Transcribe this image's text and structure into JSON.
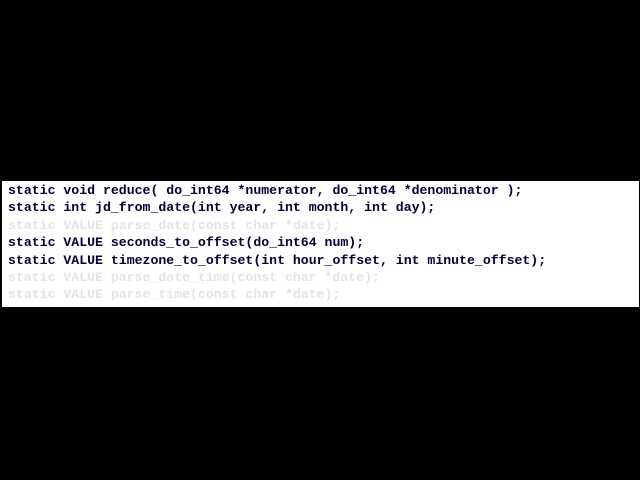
{
  "colors": {
    "background": "#000000",
    "panel": "#ffffff",
    "text_active": "#000033",
    "text_dimmed": "#e4e4e4"
  },
  "code_lines": [
    {
      "text": "static void reduce( do_int64 *numerator, do_int64 *denominator );",
      "dimmed": false
    },
    {
      "text": "static int jd_from_date(int year, int month, int day);",
      "dimmed": false
    },
    {
      "text": "static VALUE parse_date(const char *date);",
      "dimmed": true
    },
    {
      "text": "static VALUE seconds_to_offset(do_int64 num);",
      "dimmed": false
    },
    {
      "text": "static VALUE timezone_to_offset(int hour_offset, int minute_offset);",
      "dimmed": false
    },
    {
      "text": "static VALUE parse_date_time(const char *date);",
      "dimmed": true
    },
    {
      "text": "static VALUE parse_time(const char *date);",
      "dimmed": true
    }
  ]
}
